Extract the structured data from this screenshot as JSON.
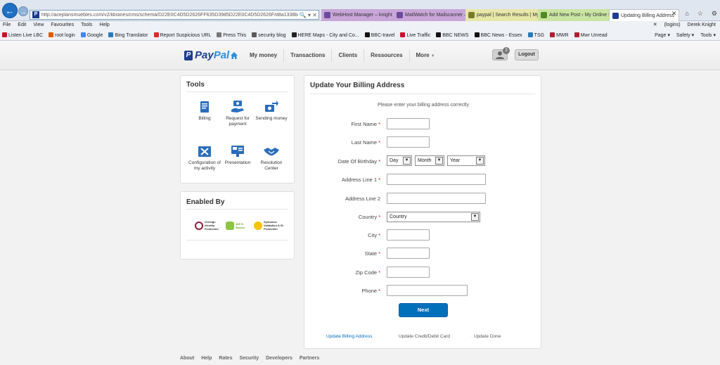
{
  "browser": {
    "address_url": "http://aceplansmuebles.com/v2/libraries/cms/schema/D22E0C4D5D2626FF635D3985D22E0C4D5D2626F/d8a1338bd088a3f066da00a41cb",
    "address_domain": "aceplansmuebles.com",
    "tabs": [
      {
        "label": "WebHost Manager – knight",
        "color": "#c8a6d8"
      },
      {
        "label": "MailWatch for Mailscanner – ...",
        "color": "#c8a6d8"
      },
      {
        "label": "paypal | Search Results | My ...",
        "color": "#e7e7a8"
      },
      {
        "label": "Add New Post ‹ My Online S...",
        "color": "#c9e5a2"
      },
      {
        "label": "Updating Billing Address",
        "color": "#ffffff"
      }
    ],
    "menu": [
      "File",
      "Edit",
      "View",
      "Favourites",
      "Tools",
      "Help"
    ],
    "menu_right": {
      "logins": "(logins)",
      "user": "Derek Knight"
    },
    "favourites": [
      "Listen Live LBC",
      "root login",
      "Google",
      "Bing Translator",
      "Report Suspicious URL",
      "Press This",
      "security blog",
      "HERE Maps - City and Co...",
      "BBC-travel",
      "Live Traffic",
      "BBC NEWS",
      "BBC News - Essex",
      "TSG",
      "MWR",
      "Mwr Unread"
    ],
    "command_bar": [
      "Page ▾",
      "Safety ▾",
      "Tools ▾"
    ]
  },
  "header": {
    "logo_pay": "Pay",
    "logo_pal": "Pal",
    "nav": [
      "My money",
      "Transactions",
      "Clients",
      "Ressources",
      "More"
    ],
    "notification_count": "3",
    "logout_label": "Logout"
  },
  "tools": {
    "title": "Tools",
    "items": [
      {
        "label": "Billing",
        "icon": "billing-icon"
      },
      {
        "label": "Request for payment",
        "icon": "request-payment-icon"
      },
      {
        "label": "Sending money",
        "icon": "send-money-icon"
      },
      {
        "label": "Configuration of my activity",
        "icon": "configuration-icon"
      },
      {
        "label": "Presentation",
        "icon": "presentation-icon"
      },
      {
        "label": "Resolution Center",
        "icon": "handshake-icon"
      }
    ]
  },
  "enabled_by": {
    "title": "Enabled By",
    "seals": [
      {
        "text": "Verisign Identity Protection"
      },
      {
        "text": "100 % Secure"
      },
      {
        "text": "Symantec Validation & ID Protection"
      }
    ]
  },
  "form": {
    "title": "Update Your Billing Address",
    "intro": "Please enter your billing address correctly",
    "fields": {
      "first_name": {
        "label": "First Name",
        "value": ""
      },
      "last_name": {
        "label": "Last Name",
        "value": ""
      },
      "dob": {
        "label": "Date Of Birthday",
        "day": "Day",
        "month": "Month",
        "year": "Year"
      },
      "address1": {
        "label": "Address Line 1",
        "value": ""
      },
      "address2": {
        "label": "Address Line 2",
        "value": ""
      },
      "country": {
        "label": "Country",
        "value": "Country"
      },
      "city": {
        "label": "City",
        "value": ""
      },
      "state": {
        "label": "State",
        "value": ""
      },
      "zip": {
        "label": "Zip Code",
        "value": ""
      },
      "phone": {
        "label": "Phone",
        "value": ""
      }
    },
    "required_marker": "*",
    "next_label": "Next",
    "steps": [
      "Update Billing Address",
      "Update Credit/Debit Card",
      "Update Done"
    ]
  },
  "footer": {
    "links": [
      "About",
      "Help",
      "Rates",
      "Security",
      "Developers",
      "Partners"
    ]
  },
  "colors": {
    "paypal_dark_blue": "#1d3d8f",
    "paypal_light_blue": "#2c8ed6",
    "button_blue": "#0070ba",
    "required_red": "#d0021b"
  }
}
